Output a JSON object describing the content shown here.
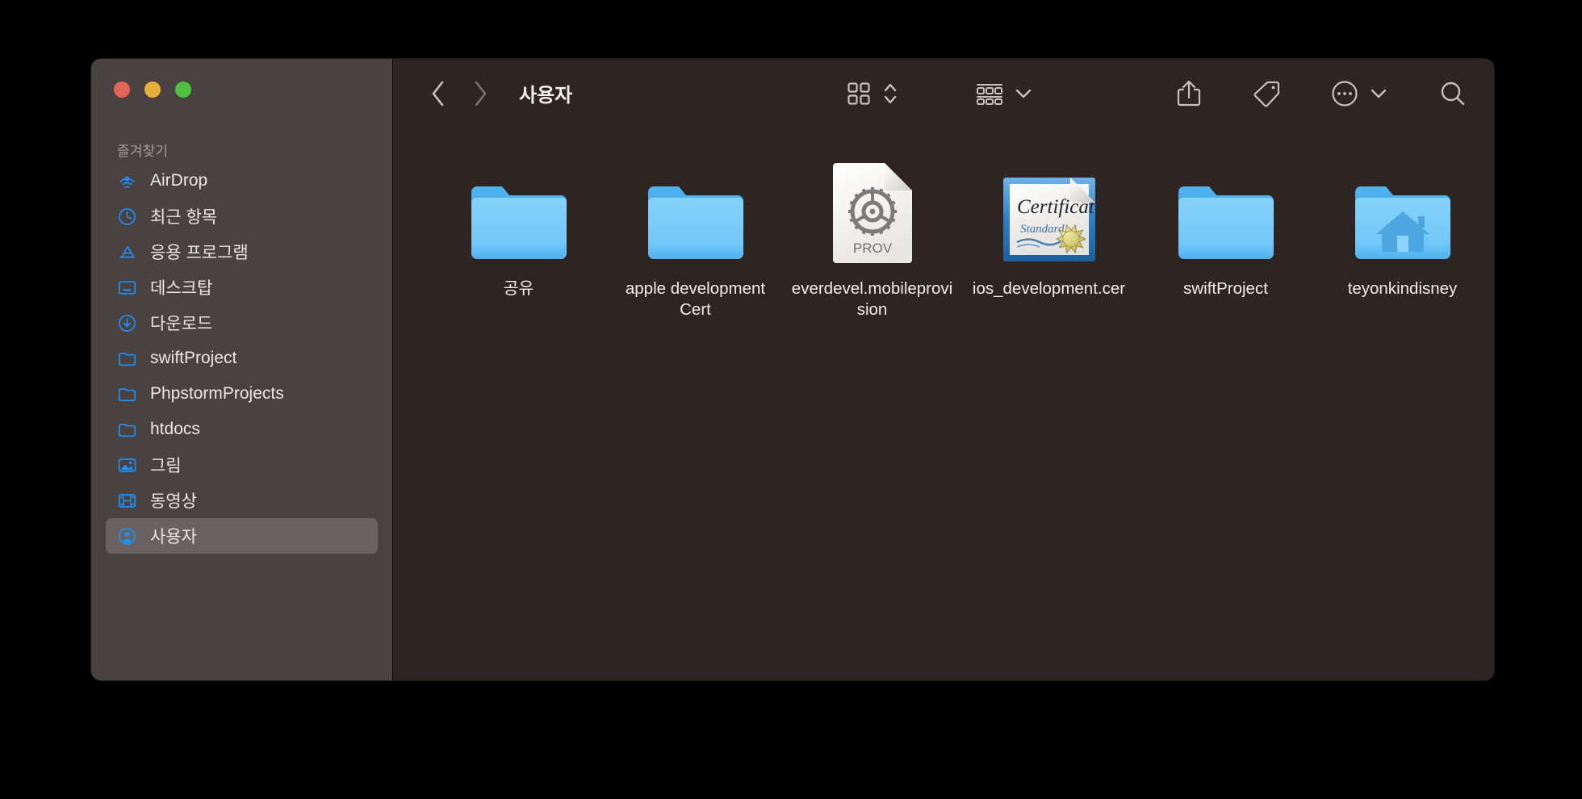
{
  "window": {
    "traffic_lights": [
      {
        "name": "close",
        "color": "#e4645a"
      },
      {
        "name": "minimize",
        "color": "#e6b03c"
      },
      {
        "name": "zoom",
        "color": "#53bf42"
      }
    ],
    "background": "#2e2523",
    "sidebar_background": "#4a4240"
  },
  "toolbar": {
    "back_icon": "chevron-left-icon",
    "forward_icon": "chevron-right-icon",
    "title": "사용자",
    "view_icon": "icon-view-grid-icon",
    "view_sort_icon": "chevron-up-down-icon",
    "group_icon": "group-items-icon",
    "group_chevron_icon": "chevron-down-icon",
    "share_icon": "share-icon",
    "tag_icon": "tag-icon",
    "more_icon": "ellipsis-circle-icon",
    "more_chevron_icon": "chevron-down-icon",
    "search_icon": "search-icon"
  },
  "sidebar": {
    "section_title": "즐겨찾기",
    "items": [
      {
        "label": "AirDrop",
        "icon": "airdrop-icon",
        "selected": false
      },
      {
        "label": "최근 항목",
        "icon": "clock-icon",
        "selected": false
      },
      {
        "label": "응용 프로그램",
        "icon": "applications-icon",
        "selected": false
      },
      {
        "label": "데스크탑",
        "icon": "desktop-icon",
        "selected": false
      },
      {
        "label": "다운로드",
        "icon": "download-icon",
        "selected": false
      },
      {
        "label": "swiftProject",
        "icon": "folder-icon",
        "selected": false
      },
      {
        "label": "PhpstormProjects",
        "icon": "folder-icon",
        "selected": false
      },
      {
        "label": "htdocs",
        "icon": "folder-icon",
        "selected": false
      },
      {
        "label": "그림",
        "icon": "pictures-icon",
        "selected": false
      },
      {
        "label": "동영상",
        "icon": "movies-icon",
        "selected": false
      },
      {
        "label": "사용자",
        "icon": "user-icon",
        "selected": true
      }
    ]
  },
  "files": [
    {
      "label": "공유",
      "icon": "folder-icon"
    },
    {
      "label": "apple development Cert",
      "icon": "folder-icon"
    },
    {
      "label": "everdevel.mobileprovision",
      "icon": "provisioning-profile-icon",
      "badge": "PROV"
    },
    {
      "label": "ios_development.cer",
      "icon": "certificate-icon",
      "certificate_text": {
        "title": "Certificate",
        "subtitle": "Standard"
      }
    },
    {
      "label": "swiftProject",
      "icon": "folder-icon"
    },
    {
      "label": "teyonkindisney",
      "icon": "home-folder-icon"
    }
  ]
}
